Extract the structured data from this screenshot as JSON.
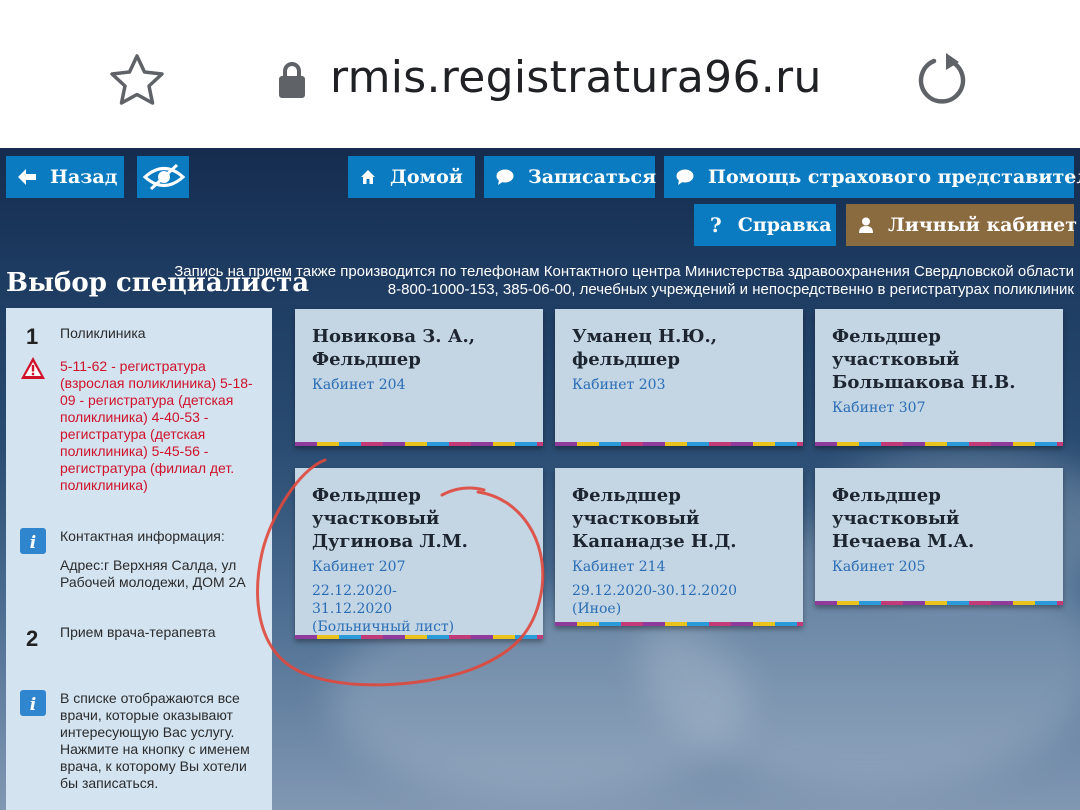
{
  "browser": {
    "url": "rmis.registratura96.ru",
    "icons": [
      "star-icon",
      "lock-icon",
      "reload-icon"
    ]
  },
  "nav": {
    "back_label": "Назад",
    "home_label": "Домой",
    "book_label": "Записаться",
    "insurance_label": "Помощь страхового представителя",
    "help_label": "Справка",
    "cabinet_label": "Личный кабинет"
  },
  "page": {
    "title": "Выбор специалиста",
    "phone_note_line1": "Запись на прием также производится по телефонам Контактного центра Министерства здравоохранения Свердловской области",
    "phone_note_line2": "8-800-1000-153, 385-06-00, лечебных учреждений и непосредственно в регистратурах поликлиник"
  },
  "panel": {
    "step1_number": "1",
    "step1_label": "Поликлиника",
    "phones": "5-11-62 - регистратура (взрослая поликлиника) 5-18-09 - регистратура (детская поликлиника) 4-40-53 - регистратура (детская поликлиника) 5-45-56 - регистратура (филиал дет. поликлиника)",
    "contact_title": "Контактная информация:",
    "address": "Адрес:г Верхняя Салда, ул Рабочей молодежи, ДОМ 2А",
    "step2_number": "2",
    "step2_label": "Прием врача-терапевта",
    "hint": "В списке отображаются все врачи, которые оказывают интересующую Вас услугу. Нажмите на кнопку с именем врача, к которому Вы хотели бы записаться."
  },
  "doctors": [
    {
      "name": "Новикова З. А., Фельдшер",
      "cabinet": "Кабинет 204"
    },
    {
      "name": "Уманец Н.Ю., фельдшер",
      "cabinet": "Кабинет 203"
    },
    {
      "name": "Фельдшер участковый Большакова Н.В.",
      "cabinet": "Кабинет 307"
    },
    {
      "name": "Фельдшер участковый Дугинова Л.М.",
      "cabinet": "Кабинет 207",
      "dates": "22.12.2020-31.12.2020 (Больничный лист)"
    },
    {
      "name": "Фельдшер участковый Капанадзе Н.Д.",
      "cabinet": "Кабинет 214",
      "dates": "29.12.2020-30.12.2020 (Иное)"
    },
    {
      "name": "Фельдшер участковый Нечаева М.А.",
      "cabinet": "Кабинет 205"
    }
  ],
  "colors": {
    "nav_blue": "#0a7bc1",
    "cabinet_brown": "#8a6a3f",
    "card_bg": "#c4d5e4",
    "link_blue": "#2a6eb5",
    "alert_red": "#d0122a",
    "annotation_red": "#e0483c"
  }
}
